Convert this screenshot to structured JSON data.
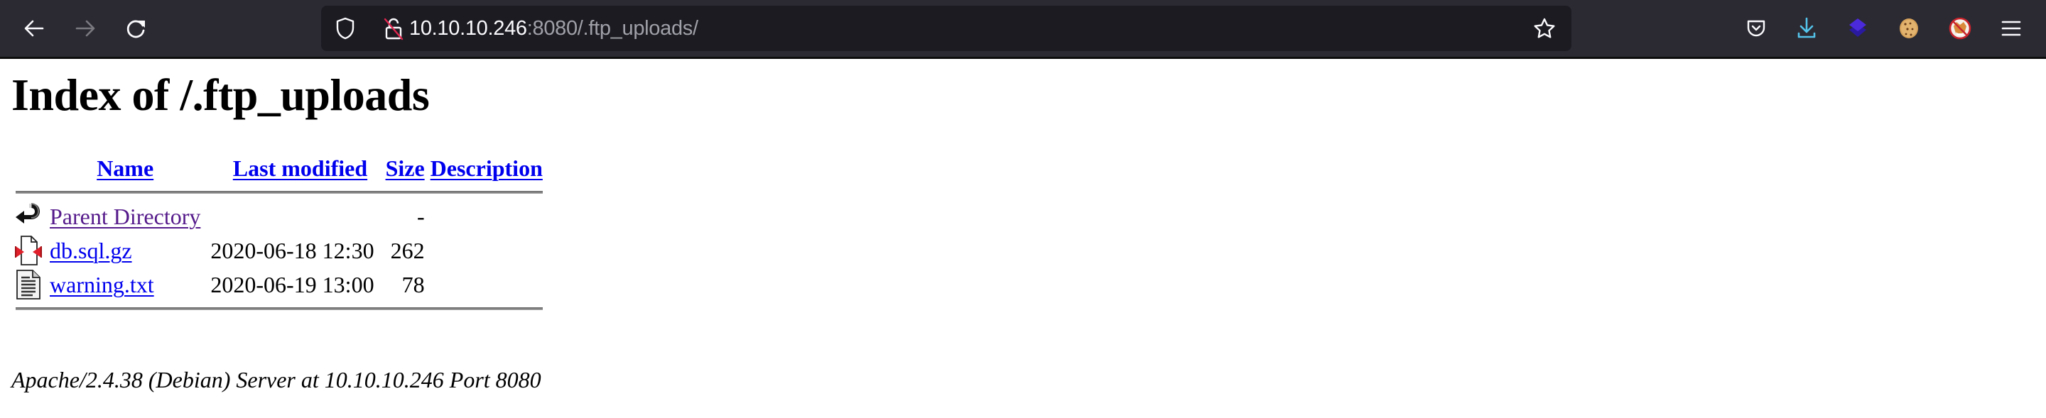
{
  "browser": {
    "nav": {
      "back_icon": "arrow-left",
      "forward_icon": "arrow-right",
      "reload_icon": "reload"
    },
    "urlbar": {
      "host": "10.10.10.246",
      "rest": ":8080/.ftp_uploads/",
      "shield_icon": "tracking-protection-shield",
      "lock_icon": "insecure-lock",
      "bookmark_icon": "star"
    },
    "toolbar_icons": [
      "pocket",
      "downloads",
      "layers-extension",
      "cookie-extension",
      "no-fox-extension",
      "hamburger-menu"
    ],
    "colors": {
      "toolbar": "#2b2a33",
      "urlbar": "#1c1b22",
      "download_accent": "#54c4ea"
    }
  },
  "page": {
    "title": "Index of /.ftp_uploads",
    "columns": {
      "name": "Name",
      "last_modified": "Last modified",
      "size": "Size",
      "description": "Description"
    },
    "rows": [
      {
        "icon": "back-arrow",
        "name": "Parent Directory",
        "last_modified": "",
        "size": "-",
        "description": "",
        "visited": true
      },
      {
        "icon": "compressed-file",
        "name": "db.sql.gz",
        "last_modified": "2020-06-18 12:30",
        "size": "262",
        "description": "",
        "visited": false
      },
      {
        "icon": "text-file",
        "name": "warning.txt",
        "last_modified": "2020-06-19 13:00",
        "size": "78",
        "description": "",
        "visited": false
      }
    ],
    "footer": "Apache/2.4.38 (Debian) Server at 10.10.10.246 Port 8080",
    "colors": {
      "link": "#0000ee",
      "visited_link": "#551a8b"
    }
  }
}
